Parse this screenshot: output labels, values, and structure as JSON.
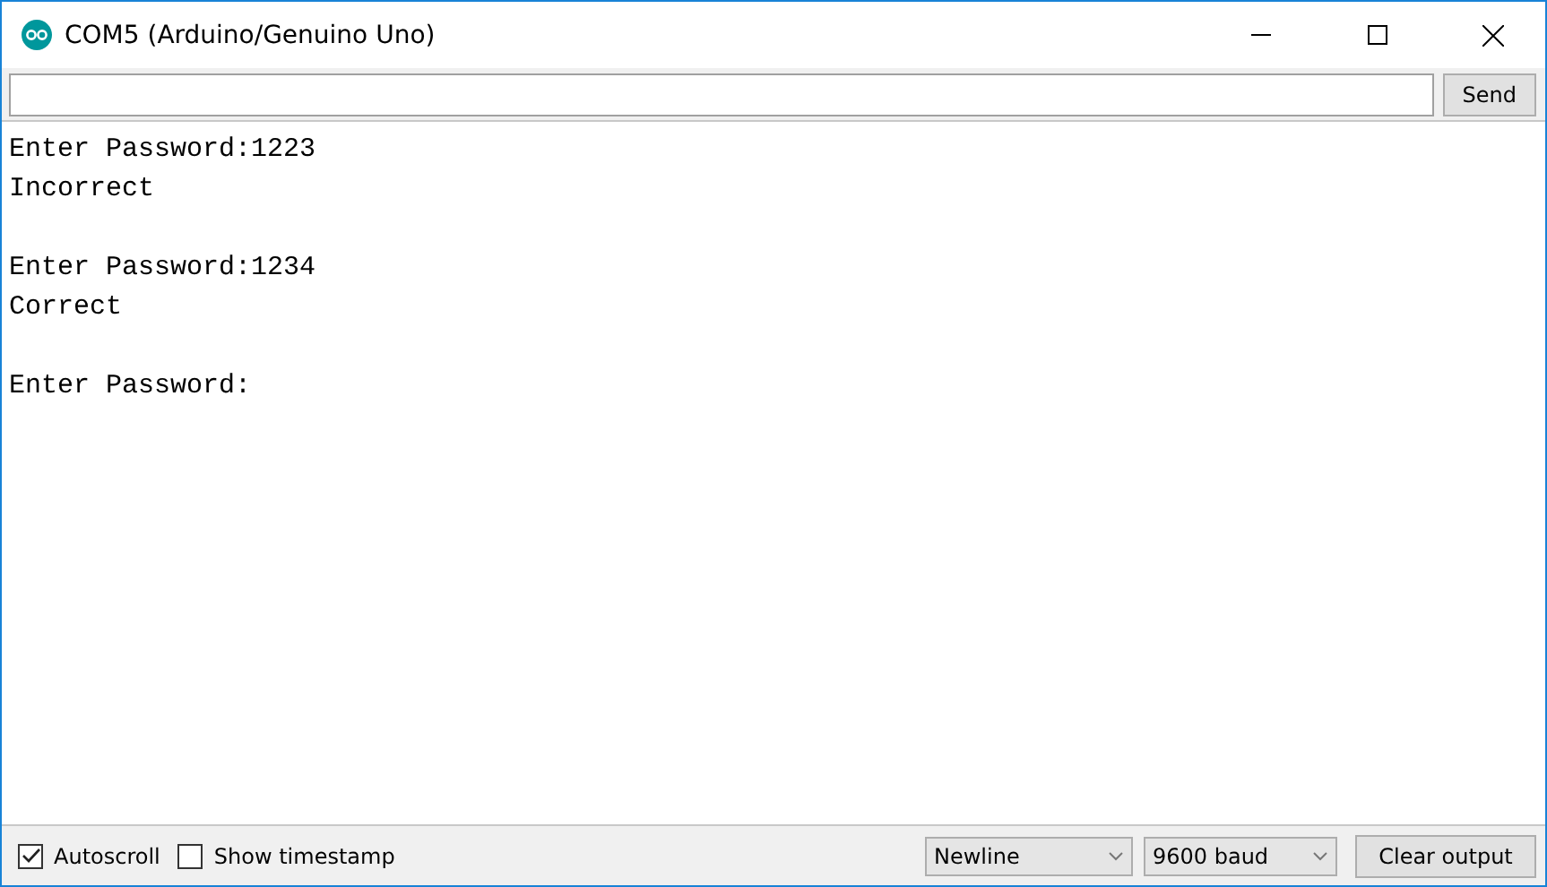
{
  "window": {
    "title": "COM5 (Arduino/Genuino Uno)"
  },
  "send_button": "Send",
  "output": [
    {
      "prompt": "Enter Password:1223",
      "response": "Incorrect"
    },
    {
      "prompt": "Enter Password:1234",
      "response": "Correct"
    },
    {
      "prompt": "Enter Password:"
    }
  ],
  "footer": {
    "autoscroll": {
      "label": "Autoscroll",
      "checked": true
    },
    "timestamp": {
      "label": "Show timestamp",
      "checked": false
    },
    "line_ending": "Newline",
    "baud": "9600 baud",
    "clear_button": "Clear output"
  }
}
